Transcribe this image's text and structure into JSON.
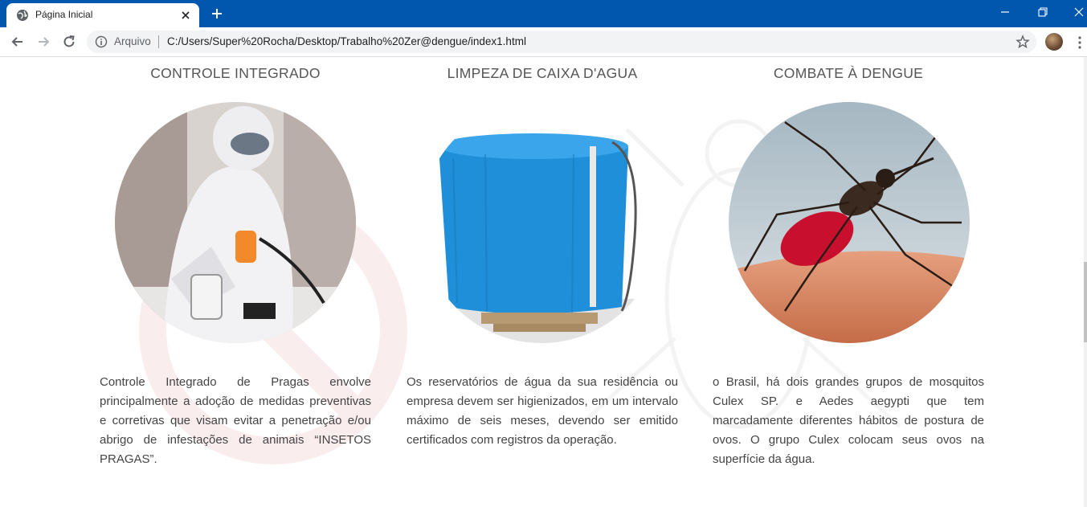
{
  "browser": {
    "tab_title": "Página Inicial",
    "omnibox_chip": "Arquivo",
    "url": "C:/Users/Super%20Rocha/Desktop/Trabalho%20Zer@dengue/index1.html"
  },
  "columns": [
    {
      "title": "CONTROLE INTEGRADO",
      "image": "pest-control-worker-photo",
      "text": "Controle Integrado de Pragas envolve principalmente a adoção de medidas preventivas e corretivas que visam evitar a penetração e/ou abrigo de infestações de animais “INSETOS PRAGAS”."
    },
    {
      "title": "LIMPEZA DE CAIXA D'AGUA",
      "image": "blue-water-tank-photo",
      "text": "Os reservatórios de água da sua residência ou empresa devem ser higienizados, em um intervalo máximo de seis meses, devendo ser emitido certificados com registros da operação."
    },
    {
      "title": "COMBATE À DENGUE",
      "image": "aedes-mosquito-photo",
      "text": "o Brasil, há dois grandes grupos de mosquitos Culex SP. e Aedes aegypti que tem marcadamente diferentes hábitos de postura de ovos. O grupo Culex colocam seus ovos na superfície da água."
    }
  ],
  "colors": {
    "titlebar": "#0157ae",
    "heading": "#555555",
    "body_text": "#444444",
    "tank_blue": "#1e8fd8"
  },
  "icons": [
    "globe-icon",
    "close-icon",
    "plus-icon",
    "minimize-icon",
    "restore-icon",
    "back-icon",
    "forward-icon",
    "reload-icon",
    "info-icon",
    "star-icon",
    "menu-icon"
  ]
}
